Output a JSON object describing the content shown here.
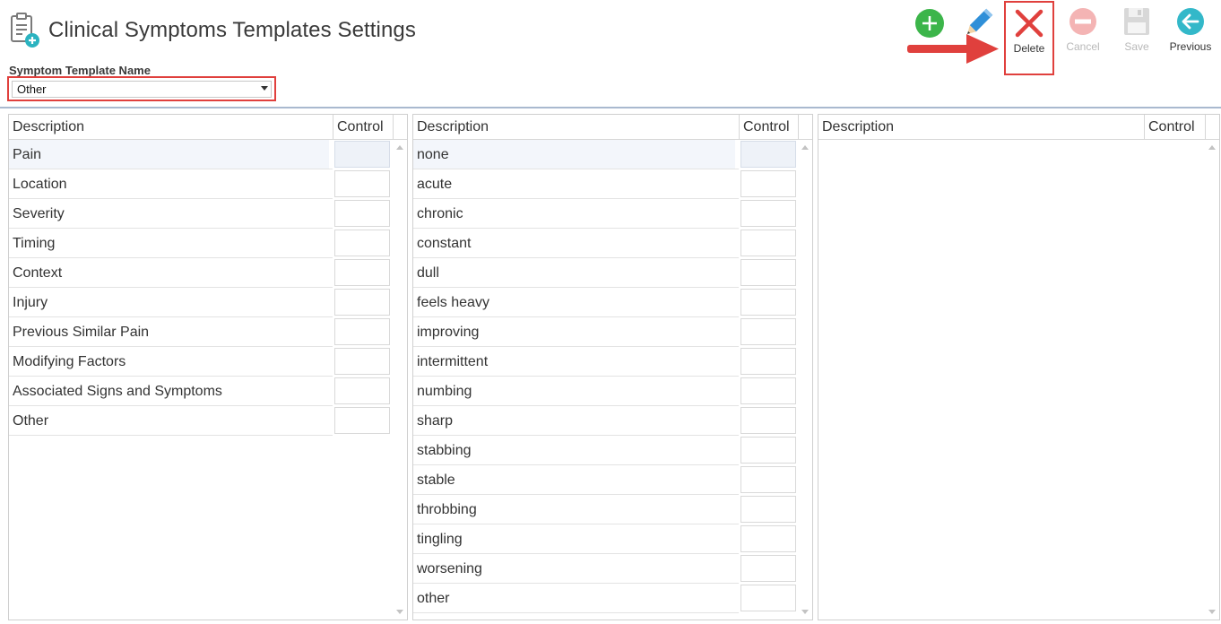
{
  "header": {
    "title": "Clinical Symptoms Templates Settings",
    "app_icon": "clipboard-add-icon"
  },
  "toolbar": {
    "add_icon": "add-circle-icon",
    "edit_icon": "pencil-icon",
    "delete_label": "Delete",
    "delete_icon": "red-x-icon",
    "cancel_label": "Cancel",
    "cancel_icon": "minus-circle-icon",
    "save_label": "Save",
    "save_icon": "floppy-disk-icon",
    "previous_label": "Previous",
    "previous_icon": "arrow-left-circle-icon"
  },
  "template_select": {
    "label": "Symptom Template Name",
    "value": "Other"
  },
  "colors": {
    "accent_red": "#e0403d",
    "add_green": "#3cb54a",
    "previous_teal": "#33b8c9",
    "pencil_blue": "#2f8fd8"
  },
  "grid1": {
    "col_description": "Description",
    "col_control": "Control",
    "selected_index": 0,
    "rows": [
      "Pain",
      "Location",
      "Severity",
      "Timing",
      "Context",
      "Injury",
      "Previous Similar Pain",
      "Modifying Factors",
      "Associated Signs and Symptoms",
      "Other"
    ]
  },
  "grid2": {
    "col_description": "Description",
    "col_control": "Control",
    "selected_index": 0,
    "rows": [
      "none",
      "acute",
      "chronic",
      "constant",
      "dull",
      "feels heavy",
      "improving",
      "intermittent",
      "numbing",
      "sharp",
      "stabbing",
      "stable",
      "throbbing",
      "tingling",
      "worsening",
      "other"
    ]
  },
  "grid3": {
    "col_description": "Description",
    "col_control": "Control",
    "rows": []
  }
}
